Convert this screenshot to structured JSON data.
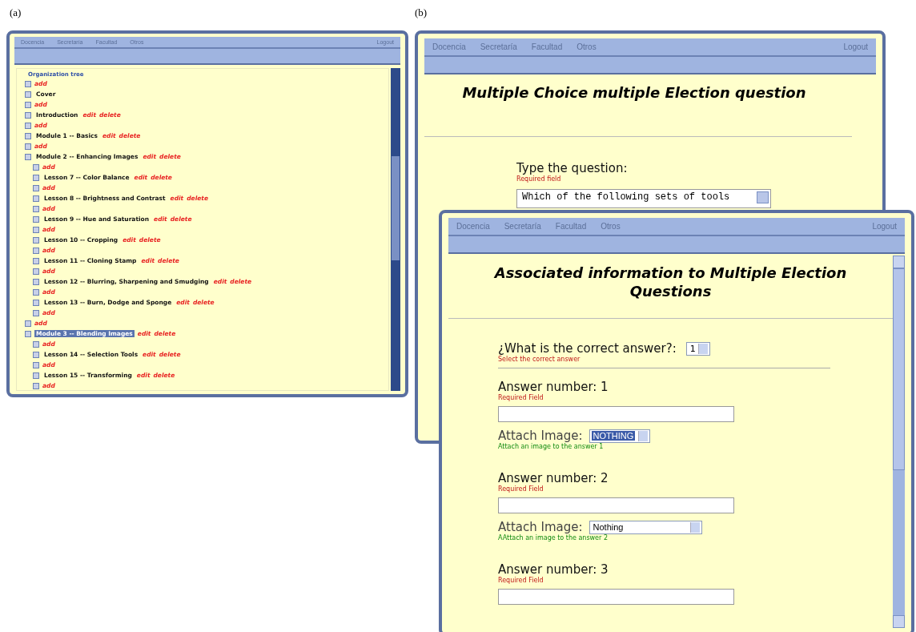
{
  "captions": [
    "(a)",
    "(b)"
  ],
  "tree_window": {
    "menu": [
      "Docencia",
      "Secretaría",
      "Facultad",
      "Otros"
    ],
    "logout": "Logout",
    "legend": "Organization tree",
    "tree": [
      {
        "kind": "add",
        "text": "add"
      },
      {
        "kind": "node",
        "label": "Cover",
        "selected": false
      },
      {
        "kind": "add",
        "text": "add"
      },
      {
        "kind": "node",
        "label": "Introduction",
        "selected": false,
        "actions": [
          "edit",
          "delete"
        ]
      },
      {
        "kind": "add",
        "text": "add"
      },
      {
        "kind": "node",
        "label": "Module 1 -- Basics",
        "selected": false,
        "actions": [
          "edit",
          "delete"
        ]
      },
      {
        "kind": "add",
        "text": "add"
      },
      {
        "kind": "node",
        "label": "Module 2 -- Enhancing Images",
        "selected": false,
        "actions": [
          "edit",
          "delete"
        ],
        "children": [
          {
            "kind": "add",
            "text": "add"
          },
          {
            "kind": "node",
            "label": "Lesson 7 -- Color Balance",
            "selected": false,
            "actions": [
              "edit",
              "delete"
            ]
          },
          {
            "kind": "add",
            "text": "add"
          },
          {
            "kind": "node",
            "label": "Lesson 8 -- Brightness and Contrast",
            "selected": false,
            "actions": [
              "edit",
              "delete"
            ]
          },
          {
            "kind": "add",
            "text": "add"
          },
          {
            "kind": "node",
            "label": "Lesson 9 -- Hue and Saturation",
            "selected": false,
            "actions": [
              "edit",
              "delete"
            ]
          },
          {
            "kind": "add",
            "text": "add"
          },
          {
            "kind": "node",
            "label": "Lesson 10 -- Cropping",
            "selected": false,
            "actions": [
              "edit",
              "delete"
            ]
          },
          {
            "kind": "add",
            "text": "add"
          },
          {
            "kind": "node",
            "label": "Lesson 11 -- Cloning Stamp",
            "selected": false,
            "actions": [
              "edit",
              "delete"
            ]
          },
          {
            "kind": "add",
            "text": "add"
          },
          {
            "kind": "node",
            "label": "Lesson 12 -- Blurring, Sharpening and Smudging",
            "selected": false,
            "actions": [
              "edit",
              "delete"
            ]
          },
          {
            "kind": "add",
            "text": "add"
          },
          {
            "kind": "node",
            "label": "Lesson 13 -- Burn, Dodge and Sponge",
            "selected": false,
            "actions": [
              "edit",
              "delete"
            ]
          },
          {
            "kind": "add",
            "text": "add"
          }
        ]
      },
      {
        "kind": "add",
        "text": "add"
      },
      {
        "kind": "node",
        "label": "Module 3 -- Blending Images",
        "selected": true,
        "actions": [
          "edit",
          "delete"
        ],
        "children": [
          {
            "kind": "add",
            "text": "add"
          },
          {
            "kind": "node",
            "label": "Lesson 14 -- Selection Tools",
            "selected": false,
            "actions": [
              "edit",
              "delete"
            ]
          },
          {
            "kind": "add",
            "text": "add"
          },
          {
            "kind": "node",
            "label": "Lesson 15 -- Transforming",
            "selected": false,
            "actions": [
              "edit",
              "delete"
            ]
          },
          {
            "kind": "add",
            "text": "add"
          }
        ]
      }
    ]
  },
  "question_window": {
    "menu": [
      "Docencia",
      "Secretaría",
      "Facultad",
      "Otros"
    ],
    "logout": "Logout",
    "title": "Multiple Choice multiple Election question",
    "question_label": "Type the question:",
    "required": "Required field",
    "question_text": "Which of the following sets of tools"
  },
  "answers_window": {
    "menu": [
      "Docencia",
      "Secretaría",
      "Facultad",
      "Otros"
    ],
    "logout": "Logout",
    "title": "Associated information to Multiple Election Questions",
    "correct": {
      "label": "¿What is the correct answer?:",
      "value": "1",
      "hint": "Select the correct answer"
    },
    "answers": [
      {
        "label": "Answer number: 1",
        "required": "Required Field",
        "attach": {
          "label": "Attach Image:",
          "value": "NOTHING",
          "selected": true,
          "hint": "Attach an image to the answer 1"
        }
      },
      {
        "label": "Answer number: 2",
        "required": "Required Field",
        "attach": {
          "label": "Attach Image:",
          "value": "Nothing",
          "selected": false,
          "hint": "AAttach an image to the answer 2"
        }
      },
      {
        "label": "Answer number: 3",
        "required": "Required Field"
      }
    ]
  }
}
